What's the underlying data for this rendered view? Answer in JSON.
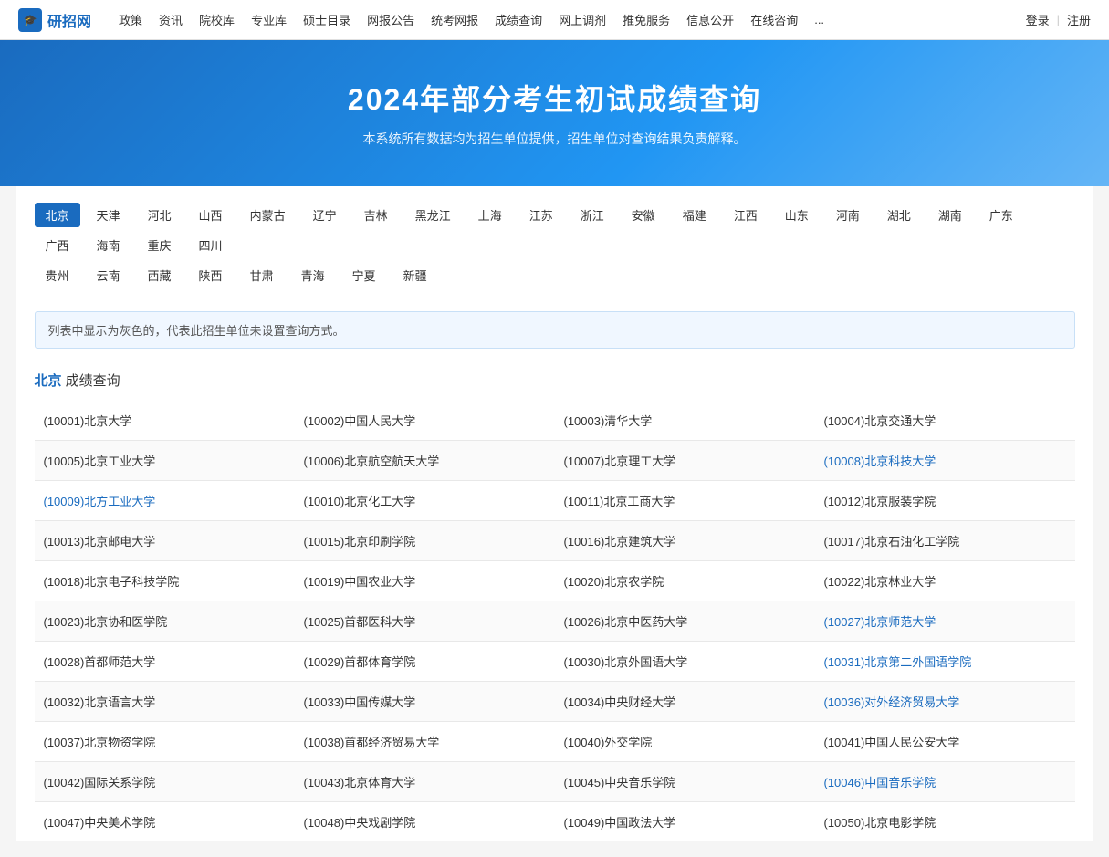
{
  "nav": {
    "logo_text": "研招网",
    "logo_icon": "🎓",
    "links": [
      "政策",
      "资讯",
      "院校库",
      "专业库",
      "硕士目录",
      "网报公告",
      "统考网报",
      "成绩查询",
      "网上调剂",
      "推免服务",
      "信息公开",
      "在线咨询",
      "..."
    ],
    "login": "登录",
    "sep": "|",
    "register": "注册"
  },
  "hero": {
    "title": "2024年部分考生初试成绩查询",
    "subtitle": "本系统所有数据均为招生单位提供，招生单位对查询结果负责解释。"
  },
  "regions": {
    "row1": [
      "北京",
      "天津",
      "河北",
      "山西",
      "内蒙古",
      "辽宁",
      "吉林",
      "黑龙江",
      "上海",
      "江苏",
      "浙江",
      "安徽",
      "福建",
      "江西",
      "山东",
      "河南",
      "湖北",
      "湖南",
      "广东",
      "广西",
      "海南",
      "重庆",
      "四川"
    ],
    "row2": [
      "贵州",
      "云南",
      "西藏",
      "陕西",
      "甘肃",
      "青海",
      "宁夏",
      "新疆"
    ],
    "active": "北京"
  },
  "info_box": "列表中显示为灰色的，代表此招生单位未设置查询方式。",
  "section_title_prefix": "北京",
  "section_title_suffix": " 成绩查询",
  "schools": [
    [
      "(10001)北京大学",
      "(10002)中国人民大学",
      "(10003)清华大学",
      "(10004)北京交通大学"
    ],
    [
      "(10005)北京工业大学",
      "(10006)北京航空航天大学",
      "(10007)北京理工大学",
      "(10008)北京科技大学"
    ],
    [
      "(10009)北方工业大学",
      "(10010)北京化工大学",
      "(10011)北京工商大学",
      "(10012)北京服装学院"
    ],
    [
      "(10013)北京邮电大学",
      "(10015)北京印刷学院",
      "(10016)北京建筑大学",
      "(10017)北京石油化工学院"
    ],
    [
      "(10018)北京电子科技学院",
      "(10019)中国农业大学",
      "(10020)北京农学院",
      "(10022)北京林业大学"
    ],
    [
      "(10023)北京协和医学院",
      "(10025)首都医科大学",
      "(10026)北京中医药大学",
      "(10027)北京师范大学"
    ],
    [
      "(10028)首都师范大学",
      "(10029)首都体育学院",
      "(10030)北京外国语大学",
      "(10031)北京第二外国语学院"
    ],
    [
      "(10032)北京语言大学",
      "(10033)中国传媒大学",
      "(10034)中央财经大学",
      "(10036)对外经济贸易大学"
    ],
    [
      "(10037)北京物资学院",
      "(10038)首都经济贸易大学",
      "(10040)外交学院",
      "(10041)中国人民公安大学"
    ],
    [
      "(10042)国际关系学院",
      "(10043)北京体育大学",
      "(10045)中央音乐学院",
      "(10046)中国音乐学院"
    ],
    [
      "(10047)中央美术学院",
      "(10048)中央戏剧学院",
      "(10049)中国政法大学",
      "(10050)北京电影学院"
    ]
  ],
  "linked_schools": [
    "(10008)北京科技大学",
    "(10009)北方工业大学",
    "(10027)北京师范大学",
    "(10031)北京第二外国语学院",
    "(10036)对外经济贸易大学",
    "(10046)中国音乐学院"
  ]
}
